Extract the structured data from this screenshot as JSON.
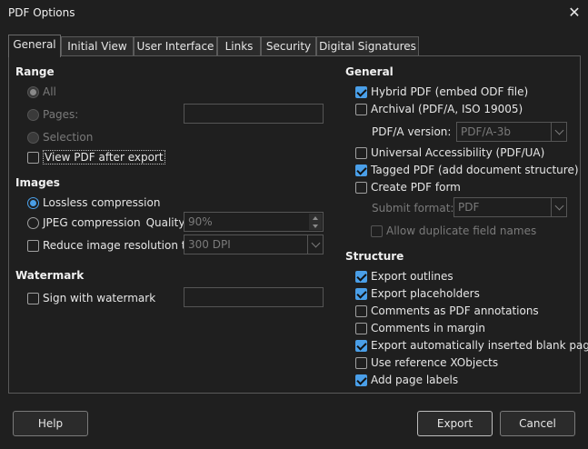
{
  "window": {
    "title": "PDF Options",
    "close_icon": "✕"
  },
  "tabs": [
    {
      "label": "General",
      "active": true
    },
    {
      "label": "Initial View",
      "active": false
    },
    {
      "label": "User Interface",
      "active": false
    },
    {
      "label": "Links",
      "active": false
    },
    {
      "label": "Security",
      "active": false
    },
    {
      "label": "Digital Signatures",
      "active": false
    }
  ],
  "range": {
    "title": "Range",
    "all": "All",
    "pages": "Pages:",
    "pages_value": "",
    "selection": "Selection",
    "view_pdf": "View PDF after export"
  },
  "images": {
    "title": "Images",
    "lossless": "Lossless compression",
    "jpeg": "JPEG compression",
    "quality_label": "Quality:",
    "quality_value": "90%",
    "reduce": "Reduce image resolution to:",
    "resolution_value": "300 DPI"
  },
  "watermark": {
    "title": "Watermark",
    "sign": "Sign with watermark",
    "value": ""
  },
  "general": {
    "title": "General",
    "hybrid": "Hybrid PDF (embed ODF file)",
    "archival": "Archival (PDF/A, ISO 19005)",
    "pdfa_label": "PDF/A version:",
    "pdfa_value": "PDF/A-3b",
    "accessibility": "Universal Accessibility (PDF/UA)",
    "tagged": "Tagged PDF (add document structure)",
    "create_form": "Create PDF form",
    "submit_label": "Submit format:",
    "submit_value": "PDF",
    "allow_dup": "Allow duplicate field names"
  },
  "structure": {
    "title": "Structure",
    "outlines": "Export outlines",
    "placeholders": "Export placeholders",
    "annotations": "Comments as PDF annotations",
    "margin": "Comments in margin",
    "blank_pages": "Export automatically inserted blank pages",
    "xobjects": "Use reference XObjects",
    "page_labels": "Add page labels"
  },
  "buttons": {
    "help": "Help",
    "export": "Export",
    "cancel": "Cancel"
  },
  "colors": {
    "accent": "#4a9fe8",
    "background": "#1f1f1f"
  }
}
